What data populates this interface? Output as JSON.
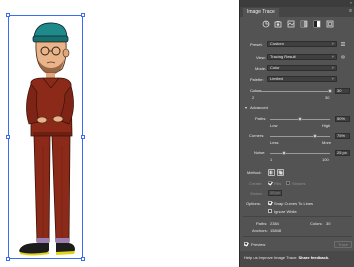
{
  "panel": {
    "title": "Image Trace",
    "menu_icon": "hamburger-menu-icon",
    "presets": [
      "auto-color-icon",
      "high-color-icon",
      "low-color-icon",
      "grayscale-icon",
      "black-and-white-icon",
      "outline-icon"
    ],
    "preset": {
      "label": "Preset:",
      "value": "Custom"
    },
    "view": {
      "label": "View:",
      "value": "Tracing Result"
    },
    "mode": {
      "label": "Mode:",
      "value": "Color"
    },
    "palette": {
      "label": "Palette:",
      "value": "Limited"
    },
    "colors": {
      "label": "Colors",
      "value": "30",
      "min": "2",
      "max": "30",
      "fraction": 1.0
    },
    "advanced": {
      "label": "Advanced"
    },
    "paths": {
      "label": "Paths:",
      "value": "50%",
      "low": "Low",
      "high": "High",
      "fraction": 0.5
    },
    "corners": {
      "label": "Corners:",
      "value": "75%",
      "less": "Less",
      "more": "More",
      "fraction": 0.75
    },
    "noise": {
      "label": "Noise:",
      "value": "25 px",
      "min": "1",
      "max": "100",
      "fraction": 0.24
    },
    "method": {
      "label": "Method:"
    },
    "create": {
      "label": "Create:",
      "fills": "Fills",
      "strokes": "Strokes"
    },
    "stroke": {
      "label": "Stroke:",
      "value": "10 px"
    },
    "options": {
      "label": "Options:",
      "snap": "Snap Curves To Lines",
      "ignore_white": "Ignore White"
    },
    "stats": {
      "paths_label": "Paths:",
      "paths_value": "2384",
      "colors_label": "Colors:",
      "colors_value": "30",
      "anchors_label": "Anchors:",
      "anchors_value": "15848"
    },
    "preview": "Preview",
    "trace_button": "Trace",
    "feedback_text": "Help us improve Image Trace:",
    "feedback_link": "Share feedback."
  },
  "colors": {
    "panel_bg": "#535353",
    "selection": "#3a6df0",
    "hat": "#1f8a8a",
    "suit": "#8c2a1a",
    "skin": "#e9b48a",
    "shoe": "#e0d414"
  }
}
